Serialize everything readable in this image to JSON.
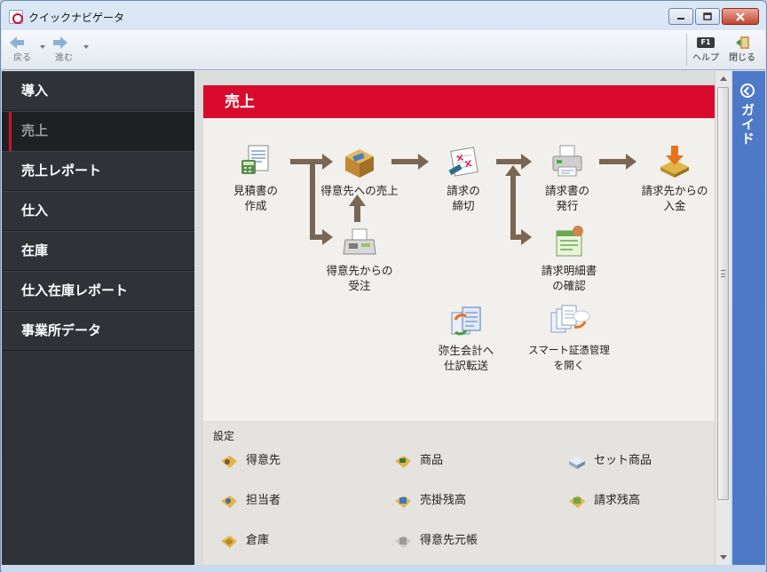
{
  "window": {
    "title": "クイックナビゲータ"
  },
  "toolbar": {
    "back_label": "戻る",
    "forward_label": "進む",
    "help_key": "F1",
    "help_label": "ヘルプ",
    "close_label": "閉じる"
  },
  "sidebar": {
    "items": [
      {
        "label": "導入"
      },
      {
        "label": "売上"
      },
      {
        "label": "売上レポート"
      },
      {
        "label": "仕入"
      },
      {
        "label": "在庫"
      },
      {
        "label": "仕入在庫レポート"
      },
      {
        "label": "事業所データ"
      }
    ],
    "active_index": 1
  },
  "main": {
    "header": "売上",
    "flow": {
      "estimate": [
        "見積書の",
        "作成"
      ],
      "sales_to_customer": [
        "得意先への売上"
      ],
      "order_from_customer": [
        "得意先からの",
        "受注"
      ],
      "billing_close": [
        "請求の",
        "締切"
      ],
      "issue_invoice": [
        "請求書の",
        "発行"
      ],
      "invoice_detail": [
        "請求明細書",
        "の確認"
      ],
      "payment_received": [
        "請求先からの",
        "入金"
      ],
      "yayoi_transfer": [
        "弥生会計へ",
        "仕訳転送"
      ],
      "smart_voucher": [
        "スマート証憑管理",
        "を開く"
      ]
    },
    "settings": {
      "title": "設定",
      "items": [
        {
          "label": "得意先",
          "icon": "customer-icon"
        },
        {
          "label": "商品",
          "icon": "product-icon"
        },
        {
          "label": "セット商品",
          "icon": "set-product-icon"
        },
        {
          "label": "担当者",
          "icon": "staff-icon"
        },
        {
          "label": "売掛残高",
          "icon": "receivable-balance-icon"
        },
        {
          "label": "請求残高",
          "icon": "billing-balance-icon"
        },
        {
          "label": "倉庫",
          "icon": "warehouse-icon"
        },
        {
          "label": "得意先元帳",
          "icon": "customer-ledger-icon"
        }
      ]
    }
  },
  "guide": {
    "label": "ガイド"
  },
  "colors": {
    "accent_red": "#d90a2c",
    "sidebar_bg": "#2f3337",
    "guide_blue": "#4d79c7",
    "arrow_brown": "#7a6654"
  }
}
